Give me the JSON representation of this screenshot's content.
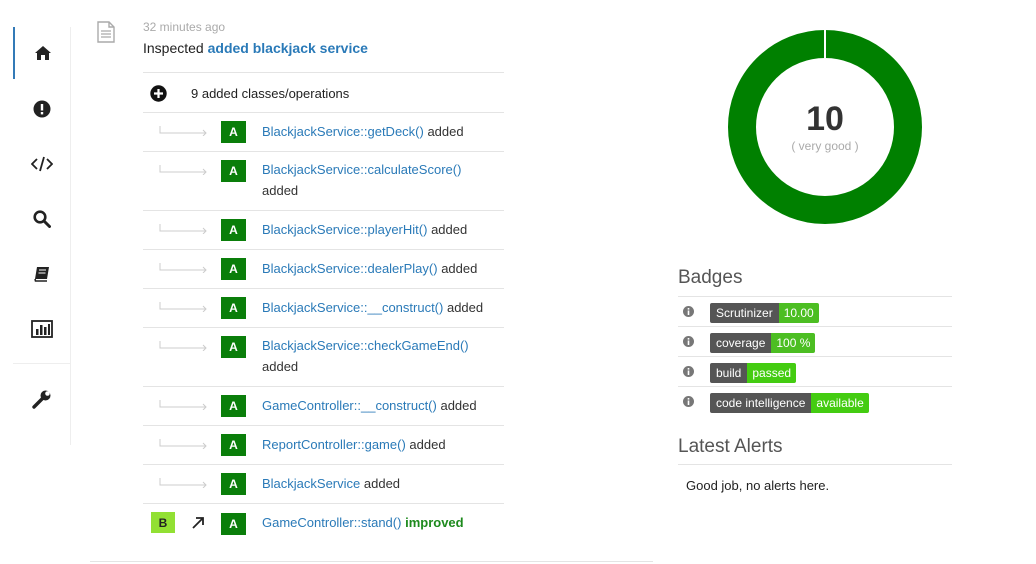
{
  "sidebar": {
    "items": [
      {
        "name": "home",
        "icon": "home-icon"
      },
      {
        "name": "issues",
        "icon": "exclamation-circle-icon"
      },
      {
        "name": "code",
        "icon": "code-icon"
      },
      {
        "name": "search",
        "icon": "search-icon"
      },
      {
        "name": "book",
        "icon": "book-icon"
      },
      {
        "name": "statistics",
        "icon": "bar-chart-icon"
      },
      {
        "name": "settings",
        "icon": "wrench-icon"
      }
    ]
  },
  "inspection": {
    "time": "32 minutes ago",
    "prefix": "Inspected",
    "link": "added blackjack service",
    "summary": "9 added classes/operations",
    "rows": [
      {
        "grade": "A",
        "name": "BlackjackService::getDeck()",
        "status": "added"
      },
      {
        "grade": "A",
        "name": "BlackjackService::calculateScore()",
        "status": "added"
      },
      {
        "grade": "A",
        "name": "BlackjackService::playerHit()",
        "status": "added"
      },
      {
        "grade": "A",
        "name": "BlackjackService::dealerPlay()",
        "status": "added"
      },
      {
        "grade": "A",
        "name": "BlackjackService::__construct()",
        "status": "added"
      },
      {
        "grade": "A",
        "name": "BlackjackService::checkGameEnd()",
        "status": "added"
      },
      {
        "grade": "A",
        "name": "GameController::__construct()",
        "status": "added"
      },
      {
        "grade": "A",
        "name": "ReportController::game()",
        "status": "added"
      },
      {
        "grade": "A",
        "name": "BlackjackService",
        "status": "added"
      }
    ],
    "improved": {
      "from_grade": "B",
      "to_grade": "A",
      "name": "GameController::stand()",
      "status": "improved"
    }
  },
  "score": {
    "value": "10",
    "label": "( very good )",
    "fraction": 1.0,
    "color": "#008000"
  },
  "badges": {
    "title": "Badges",
    "items": [
      {
        "key": "Scrutinizer",
        "value": "10.00"
      },
      {
        "key": "coverage",
        "value": "100 %"
      },
      {
        "key": "build",
        "value": "passed"
      },
      {
        "key": "code intelligence",
        "value": "available"
      }
    ]
  },
  "alerts": {
    "title": "Latest Alerts",
    "message": "Good job, no alerts here."
  },
  "colors": {
    "link": "#2a7ab8",
    "grade_a": "#0a7e0a",
    "grade_b": "#92e033",
    "badge_ok": "#4cbe22"
  }
}
